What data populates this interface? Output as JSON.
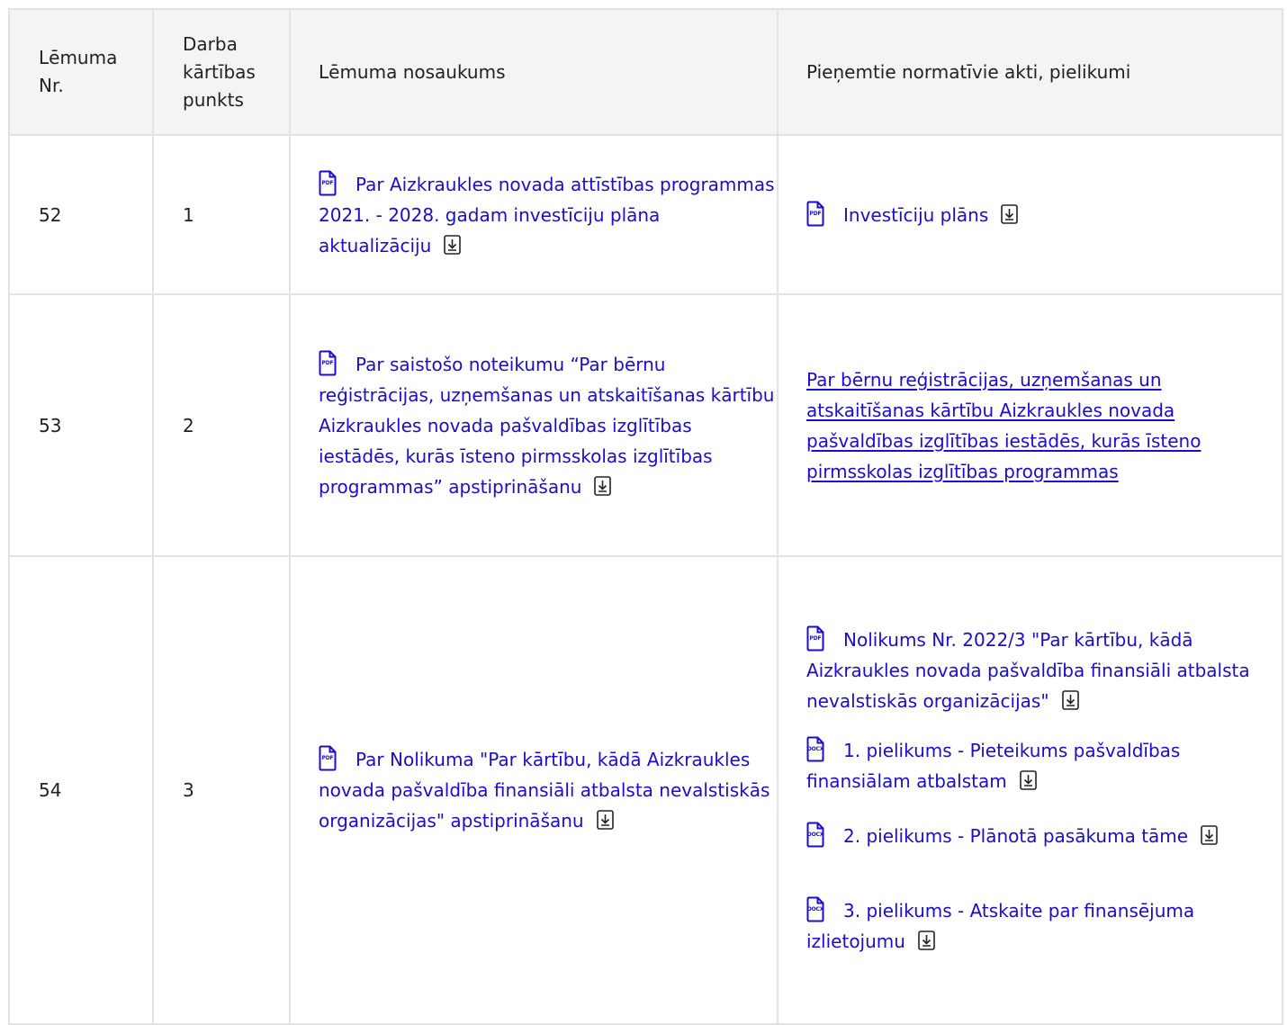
{
  "table": {
    "headers": {
      "decision_no": "Lēmuma Nr.",
      "agenda_item": "Darba kārtības punkts",
      "decision_title": "Lēmuma nosaukums",
      "adopted_acts": "Pieņemtie normatīvie akti, pielikumi"
    },
    "rows": [
      {
        "decision_no": "52",
        "agenda_item": "1",
        "title": {
          "type": "PDF",
          "text": "Par Aizkraukles novada attīstības programmas 2021. - 2028. gadam investīciju plāna aktualizāciju"
        },
        "attachments": [
          {
            "type": "PDF",
            "text": "Investīciju plāns"
          }
        ]
      },
      {
        "decision_no": "53",
        "agenda_item": "2",
        "title": {
          "type": "PDF",
          "text": "Par saistošo noteikumu “Par bērnu reģistrācijas, uzņemšanas un atskaitīšanas kārtību Aizkraukles novada pašvaldības izglītības iestādēs, kurās īsteno pirmsskolas izglītības programmas” apstiprināšanu"
        },
        "link": "Par bērnu reģistrācijas, uzņemšanas un atskaitīšanas kārtību Aizkraukles novada pašvaldības izglītības iestādēs, kurās īsteno pirmsskolas izglītības programmas"
      },
      {
        "decision_no": "54",
        "agenda_item": "3",
        "title": {
          "type": "PDF",
          "text": "Par Nolikuma \"Par kārtību, kādā Aizkraukles novada pašvaldība finansiāli atbalsta nevalstiskās organizācijas\" apstiprināšanu"
        },
        "attachments": [
          {
            "type": "PDF",
            "text": "Nolikums Nr. 2022/3 \"Par kārtību, kādā Aizkraukles novada pašvaldība finansiāli atbalsta nevalstiskās organizācijas\""
          },
          {
            "type": "DOCX",
            "text": "1. pielikums - Pieteikums pašvaldības finansiālam atbalstam"
          },
          {
            "type": "DOCX",
            "text": "2. pielikums - Plānotā pasākuma tāme"
          },
          {
            "type": "DOCX",
            "text": "3. pielikums - Atskaite par finansējuma izlietojumu"
          }
        ]
      }
    ]
  },
  "icons": {
    "file_type": "file-document-icon",
    "download": "download-icon"
  },
  "colors": {
    "link": "#1a0dcc",
    "header_bg": "#f4f4f4",
    "border": "#e3e3e3",
    "text": "#222222"
  }
}
